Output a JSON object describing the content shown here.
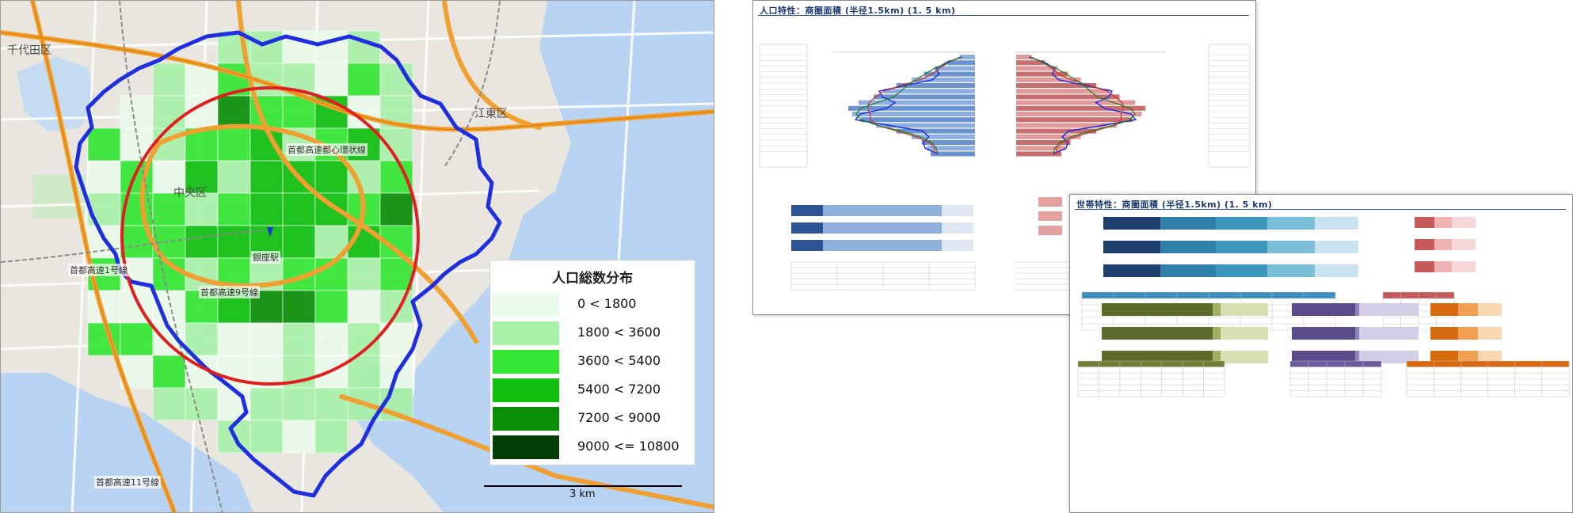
{
  "map": {
    "districts": [
      "千代田区",
      "江東区",
      "中央区"
    ],
    "station": "銀座駅",
    "highways": [
      "首都高速1号線",
      "首都高速9号線",
      "首都高速都心環状線",
      "首都高速11号線"
    ],
    "legend": {
      "title": "人口総数分布",
      "classes": [
        {
          "label": "0 <  1800",
          "color": "#eafaea"
        },
        {
          "label": "1800 <  3600",
          "color": "#a8f0a8"
        },
        {
          "label": "3600 <  5400",
          "color": "#33e633"
        },
        {
          "label": "5400 <  7200",
          "color": "#0fc00f"
        },
        {
          "label": "7200 <  9000",
          "color": "#0a8e0a"
        },
        {
          "label": "9000 <=  10800",
          "color": "#053f05"
        }
      ]
    },
    "scale_label": "3 km",
    "colors": {
      "boundary": "#1f2fe0",
      "circle": "#e02020",
      "water": "#b9d3f2",
      "land": "#ece9e2"
    }
  },
  "report_back": {
    "title": "人口特性：商圏面積 (半径1.5km)    (1. 5 km)"
  },
  "report_front": {
    "title": "世帯特性：商圏面積 (半径1.5km)    (1. 5 km)"
  }
}
